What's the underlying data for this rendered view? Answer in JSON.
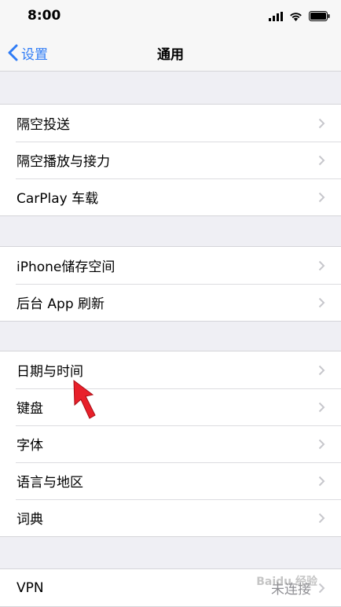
{
  "status_bar": {
    "time": "8:00",
    "icons": [
      "cellular-signal-icon",
      "wifi-icon",
      "battery-icon"
    ]
  },
  "nav": {
    "back_label": "设置",
    "title": "通用"
  },
  "groups": [
    {
      "rows": [
        {
          "label": "隔空投送"
        },
        {
          "label": "隔空播放与接力"
        },
        {
          "label": "CarPlay 车载"
        }
      ]
    },
    {
      "rows": [
        {
          "label": "iPhone储存空间"
        },
        {
          "label": "后台 App 刷新"
        }
      ]
    },
    {
      "rows": [
        {
          "label": "日期与时间"
        },
        {
          "label": "键盘"
        },
        {
          "label": "字体"
        },
        {
          "label": "语言与地区"
        },
        {
          "label": "词典"
        }
      ]
    },
    {
      "rows": [
        {
          "label": "VPN",
          "value": "未连接"
        }
      ]
    }
  ],
  "annotation": {
    "arrow_color": "#e8202a"
  },
  "watermark": {
    "text": "Baidu 经验"
  },
  "colors": {
    "accent": "#2f7cf6",
    "background": "#efeff4",
    "chevron": "#c7c7cc"
  }
}
